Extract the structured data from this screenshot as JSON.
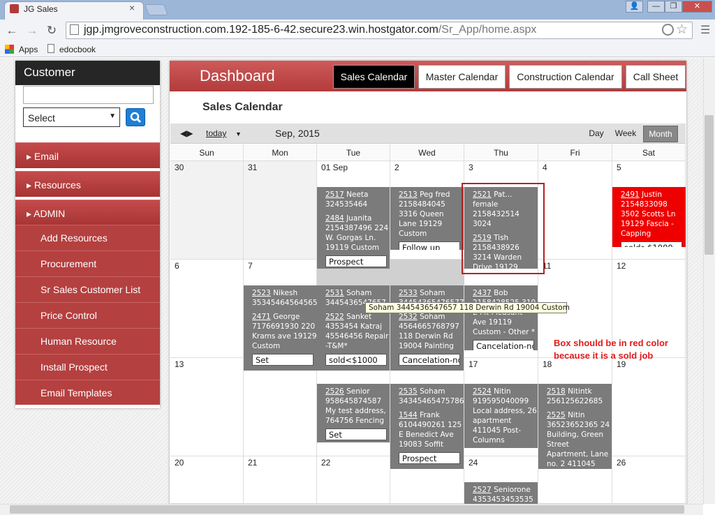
{
  "browser": {
    "tab_title": "JG Sales",
    "tab_close": "×",
    "url_host": "jgp.jmgroveconstruction.com.192-185-6-42.secure23.win.hostgator.com",
    "url_path": "/Sr_App/home.aspx",
    "back": "←",
    "forward": "→",
    "reload": "↻",
    "bookmarks": [
      "Apps",
      "edocbook"
    ],
    "win_controls": [
      "👤",
      "—",
      "❐",
      "✕"
    ]
  },
  "sidebar": {
    "title": "Customer",
    "search_value": "",
    "select_value": "Select",
    "sections": [
      {
        "label": "Email",
        "arrow": "▸"
      },
      {
        "label": "Resources",
        "arrow": "▸"
      },
      {
        "label": "ADMIN",
        "arrow": "▸"
      }
    ],
    "items": [
      "Add Resources",
      "Procurement",
      "Sr Sales Customer List",
      "Price Control",
      "Human Resource",
      "Install Prospect",
      "Email Templates"
    ]
  },
  "header": {
    "title": "Dashboard",
    "tabs": [
      {
        "label": "Sales Calendar",
        "active": true
      },
      {
        "label": "Master Calendar",
        "active": false
      },
      {
        "label": "Construction Calendar",
        "active": false
      },
      {
        "label": "Call Sheet",
        "active": false
      }
    ]
  },
  "calendar": {
    "section_title": "Sales Calendar",
    "nav_prev": "◀",
    "nav_next": "▶",
    "today": "today",
    "dropdown": "▼",
    "month_label": "Sep, 2015",
    "views": [
      {
        "label": "Day",
        "active": false
      },
      {
        "label": "Week",
        "active": false
      },
      {
        "label": "Month",
        "active": true
      }
    ],
    "day_names": [
      "Sun",
      "Mon",
      "Tue",
      "Wed",
      "Thu",
      "Fri",
      "Sat"
    ],
    "weeks": [
      [
        "30",
        "31",
        "01 Sep",
        "2",
        "3",
        "4",
        "5"
      ],
      [
        "6",
        "7",
        "8",
        "9",
        "10",
        "11",
        "12"
      ],
      [
        "13",
        "14",
        "15",
        "16",
        "17",
        "18",
        "19"
      ],
      [
        "20",
        "21",
        "22",
        "23",
        "24",
        "25",
        "26"
      ]
    ],
    "events": {
      "tue_w1": {
        "entries": [
          {
            "id": "2517",
            "text": " Neeta 324535464"
          },
          {
            "id": "2484",
            "text": " Juanita 2154387496 224 W. Gorgas Ln. 19119 Custom"
          }
        ],
        "status": "Prospect"
      },
      "wed_w1": {
        "entries": [
          {
            "id": "2513",
            "text": " Peg fred 2158484045 3316 Queen Lane 19129 Custom"
          }
        ],
        "status": "Follow up"
      },
      "thu_w1": {
        "entries": [
          {
            "id": "2521",
            "text": " Pat... female 2158432514 3024"
          },
          {
            "id": "2519",
            "text": " Tish 2158438926 3214 Warden Drive 19129 Custom"
          }
        ],
        "status": "sold>$1000"
      },
      "sat_w1": {
        "entries": [
          {
            "id": "2491",
            "text": " Justin 2154833098 3502 Scotts Ln 19129 Fascia - Capping"
          }
        ],
        "status": "sold>$1000"
      },
      "mon_w2": {
        "entries": [
          {
            "id": "2523",
            "text": " Nikesh 35345464564565456"
          },
          {
            "id": "2471",
            "text": " George 7176691930 220 Krams ave 19129 Custom"
          }
        ],
        "status": "Set"
      },
      "tue_w2": {
        "entries": [
          {
            "id": "2531",
            "text": " Soham 3445436547657"
          },
          {
            "id": "2522",
            "text": " Sanket 4353454 Katraj 45546456 Repair -T&M*"
          }
        ],
        "status": "sold<$1000"
      },
      "wed_w2": {
        "entries": [
          {
            "id": "2533",
            "text": " Soham 34454365476577"
          },
          {
            "id": "2532",
            "text": " Soham 4564665768797 118 Derwin Rd 19004 Painting"
          }
        ],
        "status": "Cancelation-no"
      },
      "thu_w2": {
        "entries": [
          {
            "id": "2437",
            "text": " Bob 2158428525 310 E Mt Pleasant Ave 19119 Custom - Other *"
          }
        ],
        "status": "Cancelation-no"
      },
      "tue_w3": {
        "entries": [
          {
            "id": "2526",
            "text": " Senior 958645874587 My test address, 764756 Fencing"
          }
        ],
        "status": "Set"
      },
      "wed_w3": {
        "entries": [
          {
            "id": "2535",
            "text": " Soham 343454654757868"
          },
          {
            "id": "1544",
            "text": " Frank 6104490261 125 E Benedict Ave 19083 Soffit"
          }
        ],
        "status": "Prospect"
      },
      "thu_w3": {
        "entries": [
          {
            "id": "2524",
            "text": " Nitin 919595040099 Local address, 26 apartment 411045 Post-Columns"
          }
        ],
        "status": ""
      },
      "fri_w3": {
        "entries": [
          {
            "id": "2518",
            "text": " Nitintk 256125622685"
          },
          {
            "id": "2525",
            "text": " Nitin 36523652365 24 Building, Green Street Apartment, Lane no. 2 411045"
          }
        ],
        "status": ""
      },
      "thu_w4": {
        "entries": [
          {
            "id": "2527",
            "text": " Seniorone 4353453453535"
          }
        ],
        "status": ""
      }
    },
    "tooltip": "Soham   3445436547657   118 Derwin Rd  19004    Custom",
    "annotation": "Box should be in red color because it is a sold job"
  },
  "colors": {
    "accent": "#b23b3b",
    "event": "#7b7b7b",
    "sold": "#ee0000",
    "note": "#e01c1c"
  }
}
